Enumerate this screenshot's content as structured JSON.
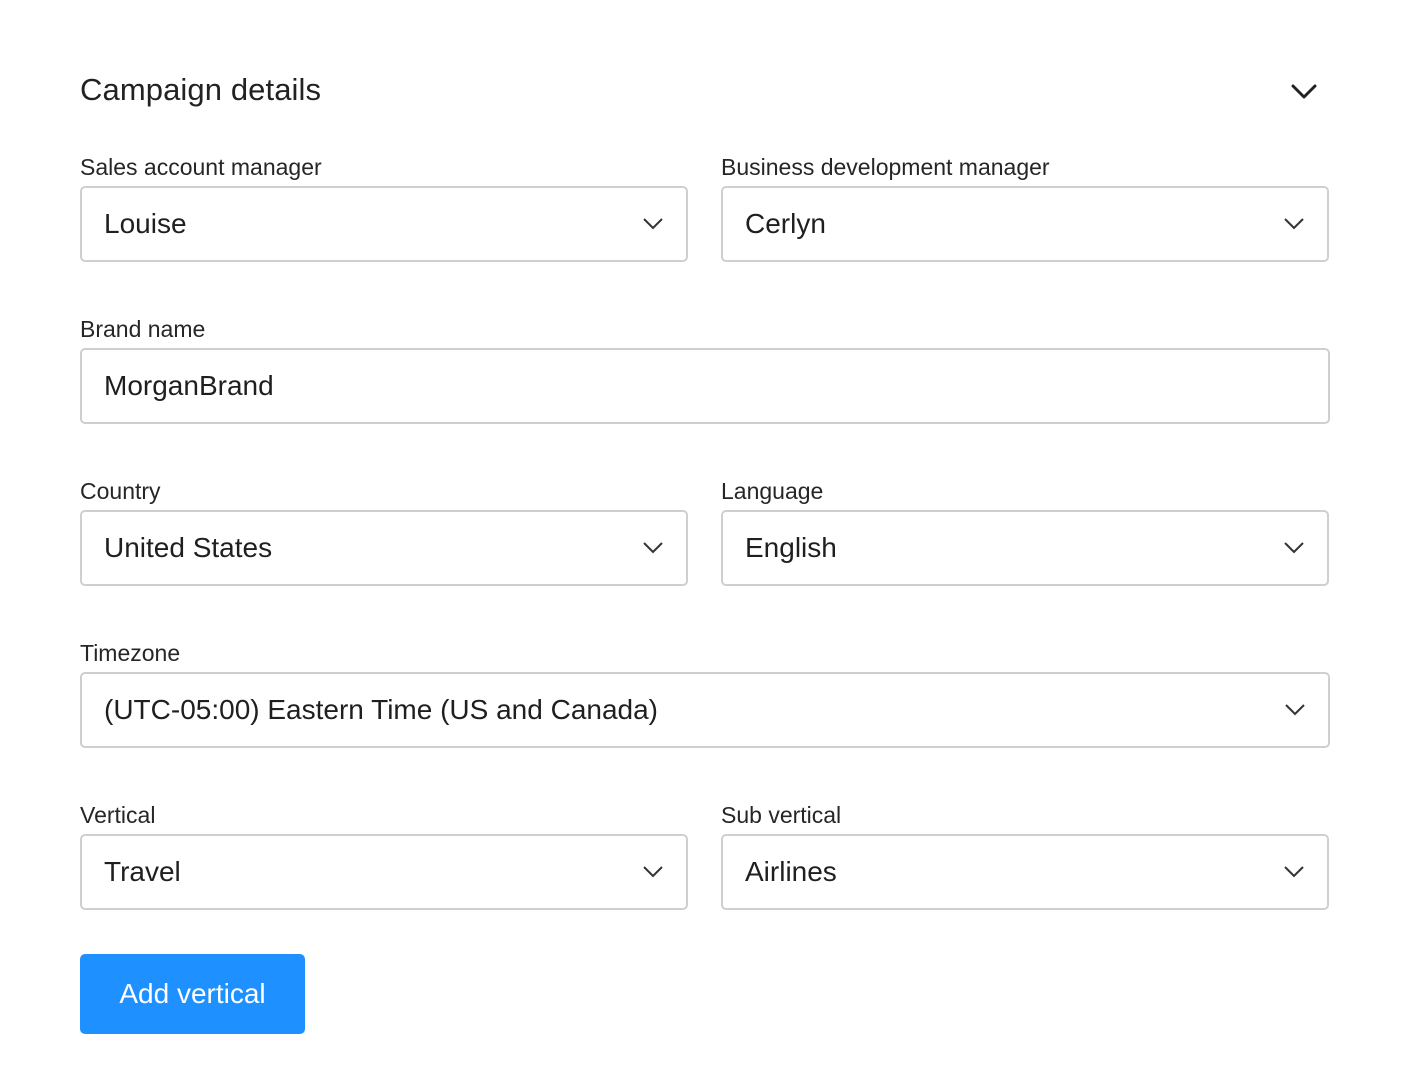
{
  "section": {
    "title": "Campaign details"
  },
  "fields": {
    "sales_account_manager": {
      "label": "Sales account manager",
      "value": "Louise"
    },
    "business_development_manager": {
      "label": "Business development manager",
      "value": "Cerlyn"
    },
    "brand_name": {
      "label": "Brand name",
      "value": "MorganBrand"
    },
    "country": {
      "label": "Country",
      "value": "United States"
    },
    "language": {
      "label": "Language",
      "value": "English"
    },
    "timezone": {
      "label": "Timezone",
      "value": "(UTC-05:00) Eastern Time (US and Canada)"
    },
    "vertical": {
      "label": "Vertical",
      "value": "Travel"
    },
    "sub_vertical": {
      "label": "Sub vertical",
      "value": "Airlines"
    }
  },
  "actions": {
    "add_vertical_label": "Add vertical"
  },
  "colors": {
    "primary_button": "#1e90ff",
    "field_border": "#cfcfcf",
    "text": "#1f1f1f"
  },
  "icons": {
    "collapse": "chevron-down-icon",
    "select": "chevron-down-icon"
  }
}
